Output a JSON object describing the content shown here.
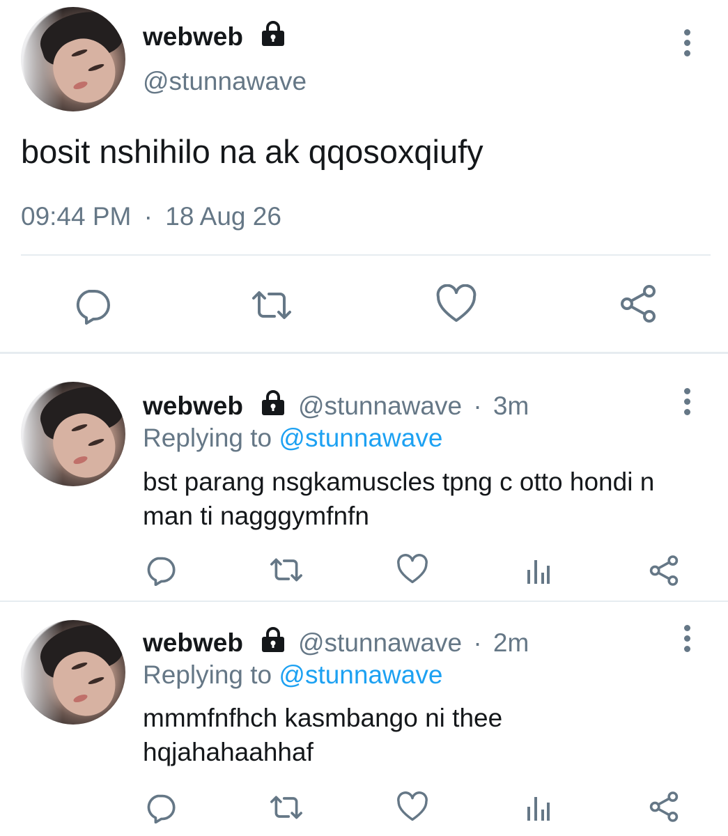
{
  "main_tweet": {
    "display_name": "webweb",
    "handle": "@stunnawave",
    "text": "bosit nshihilo na ak qqosoxqiufy",
    "time": "09:44 PM",
    "separator": "·",
    "date": "18 Aug 26"
  },
  "replies": [
    {
      "display_name": "webweb",
      "handle": "@stunnawave",
      "separator": "·",
      "age": "3m",
      "replying_prefix": "Replying to",
      "replying_handle": "@stunnawave",
      "text": "bst parang nsgkamuscles tpng c otto hondi n man ti nagggymfnfn"
    },
    {
      "display_name": "webweb",
      "handle": "@stunnawave",
      "separator": "·",
      "age": "2m",
      "replying_prefix": "Replying to",
      "replying_handle": "@stunnawave",
      "text": "mmmfnfhch kasmbango ni thee hqjahahaahhaf"
    }
  ],
  "icons": {
    "lock": "lock-icon",
    "more": "more-vertical-icon",
    "reply": "reply-icon",
    "retweet": "retweet-icon",
    "like": "heart-icon",
    "analytics": "analytics-icon",
    "share": "share-icon"
  },
  "colors": {
    "text": "#14171a",
    "secondary": "#657786",
    "link": "#1da1f2",
    "divider": "#e6ecf0"
  }
}
